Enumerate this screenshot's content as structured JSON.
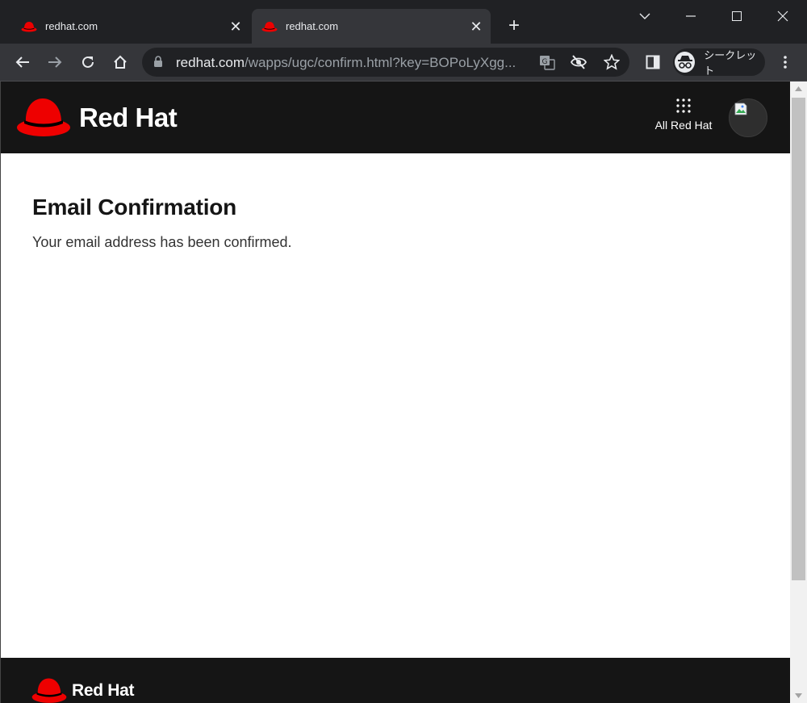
{
  "browser": {
    "tabs": [
      {
        "title": "redhat.com",
        "active": false
      },
      {
        "title": "redhat.com",
        "active": true
      }
    ],
    "new_tab_icon": "plus-icon",
    "address": {
      "host": "redhat.com",
      "path": "/wapps/ugc/confirm.html?key=BOPoLyXgg..."
    },
    "profile_label": "シークレット",
    "icons": [
      "back-icon",
      "forward-icon",
      "reload-icon",
      "home-icon",
      "lock-icon",
      "translate-icon",
      "eye-off-icon",
      "star-icon",
      "side-panel-icon",
      "incognito-icon",
      "menu-icon"
    ]
  },
  "site": {
    "brand": "Red Hat",
    "nav_label": "All Red Hat",
    "accent": "#ee0000",
    "header_bg": "#151515"
  },
  "main": {
    "heading": "Email Confirmation",
    "message": "Your email address has been confirmed."
  },
  "footer": {
    "brand": "Red Hat"
  }
}
